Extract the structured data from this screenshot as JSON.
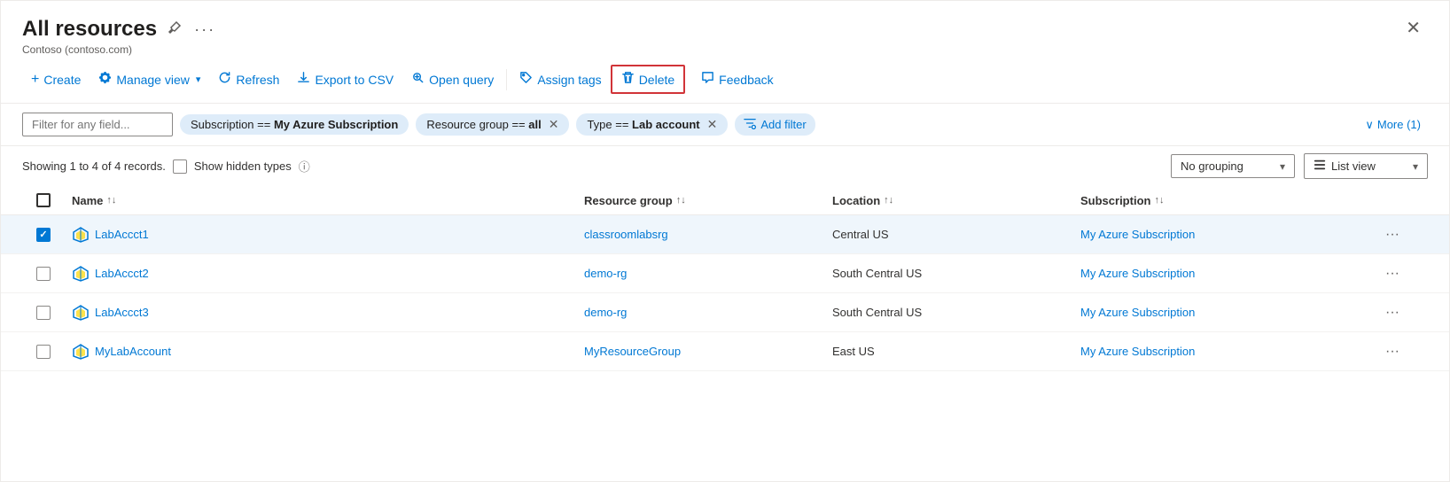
{
  "header": {
    "title": "All resources",
    "subtitle": "Contoso (contoso.com)",
    "pin_icon": "📌",
    "ellipsis_icon": "···",
    "close_icon": "✕"
  },
  "toolbar": {
    "create_label": "Create",
    "manage_view_label": "Manage view",
    "refresh_label": "Refresh",
    "export_csv_label": "Export to CSV",
    "open_query_label": "Open query",
    "assign_tags_label": "Assign tags",
    "delete_label": "Delete",
    "feedback_label": "Feedback"
  },
  "filters": {
    "placeholder": "Filter for any field...",
    "chips": [
      {
        "label": "Subscription == ",
        "bold": "My Azure Subscription",
        "removable": false
      },
      {
        "label": "Resource group == ",
        "bold": "all",
        "removable": true
      },
      {
        "label": "Type == ",
        "bold": "Lab account",
        "removable": true
      }
    ],
    "add_filter_label": "Add filter",
    "more_label": "More (1)"
  },
  "records": {
    "text": "Showing 1 to 4 of 4 records.",
    "show_hidden_label": "Show hidden types",
    "grouping_label": "No grouping",
    "view_label": "List view"
  },
  "table": {
    "columns": [
      {
        "label": "Name",
        "sortable": true
      },
      {
        "label": "Resource group",
        "sortable": true
      },
      {
        "label": "Location",
        "sortable": true
      },
      {
        "label": "Subscription",
        "sortable": true
      }
    ],
    "rows": [
      {
        "selected": true,
        "name": "LabAccct1",
        "resource_group": "classroomlabsrg",
        "location": "Central US",
        "subscription": "My Azure Subscription"
      },
      {
        "selected": false,
        "name": "LabAccct2",
        "resource_group": "demo-rg",
        "location": "South Central US",
        "subscription": "My Azure Subscription"
      },
      {
        "selected": false,
        "name": "LabAccct3",
        "resource_group": "demo-rg",
        "location": "South Central US",
        "subscription": "My Azure Subscription"
      },
      {
        "selected": false,
        "name": "MyLabAccount",
        "resource_group": "MyResourceGroup",
        "location": "East US",
        "subscription": "My Azure Subscription"
      }
    ]
  }
}
